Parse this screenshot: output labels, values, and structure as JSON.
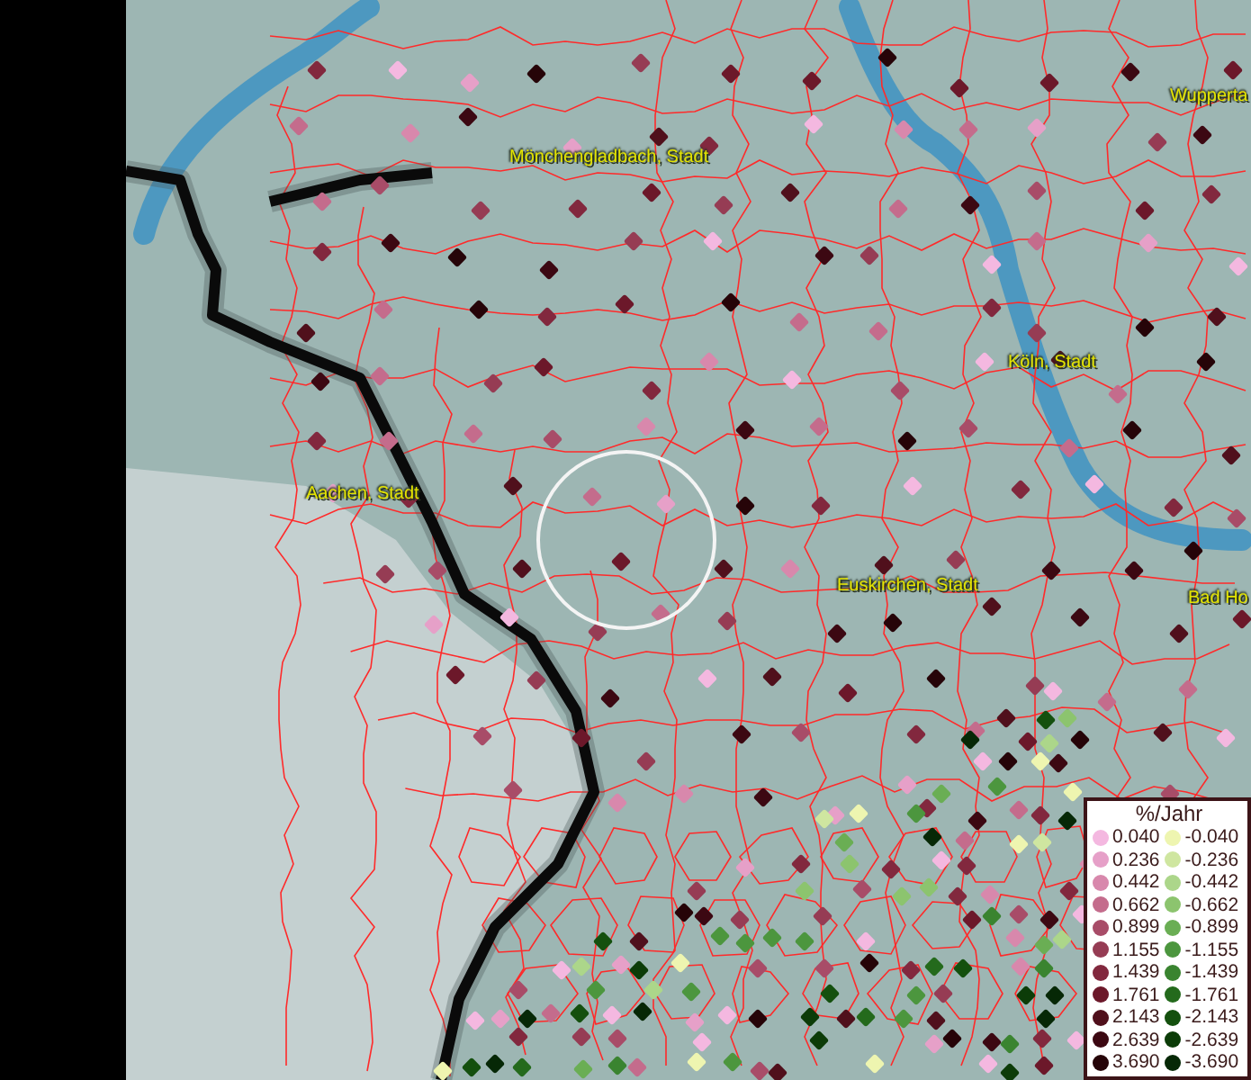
{
  "map": {
    "place_labels": [
      "Mönchengladbach, Stadt",
      "Aachen, Stadt",
      "Köln, Stadt",
      "Euskirchen, Stadt",
      "Wupperta",
      "Bad Ho"
    ]
  },
  "legend": {
    "title": "%/Jahr",
    "positive": [
      {
        "label": "0.040",
        "color": "#f4b8e0"
      },
      {
        "label": "0.236",
        "color": "#e6a0c8"
      },
      {
        "label": "0.442",
        "color": "#d888ac"
      },
      {
        "label": "0.662",
        "color": "#c46c8c"
      },
      {
        "label": "0.899",
        "color": "#a84c68"
      },
      {
        "label": "1.155",
        "color": "#963c54"
      },
      {
        "label": "1.439",
        "color": "#82283e"
      },
      {
        "label": "1.761",
        "color": "#6c182a"
      },
      {
        "label": "2.143",
        "color": "#50101c"
      },
      {
        "label": "2.639",
        "color": "#3c0812"
      },
      {
        "label": "3.690",
        "color": "#260408"
      }
    ],
    "negative": [
      {
        "label": "-0.040",
        "color": "#eef5b0"
      },
      {
        "label": "-0.236",
        "color": "#cfe6a0"
      },
      {
        "label": "-0.442",
        "color": "#acd68a"
      },
      {
        "label": "-0.662",
        "color": "#8cc46e"
      },
      {
        "label": "-0.899",
        "color": "#6aae54"
      },
      {
        "label": "-1.155",
        "color": "#4c963e"
      },
      {
        "label": "-1.439",
        "color": "#3a8430"
      },
      {
        "label": "-1.761",
        "color": "#246a1c"
      },
      {
        "label": "-2.143",
        "color": "#14500e"
      },
      {
        "label": "-2.639",
        "color": "#0c3c08"
      },
      {
        "label": "-3.690",
        "color": "#062806"
      }
    ]
  }
}
